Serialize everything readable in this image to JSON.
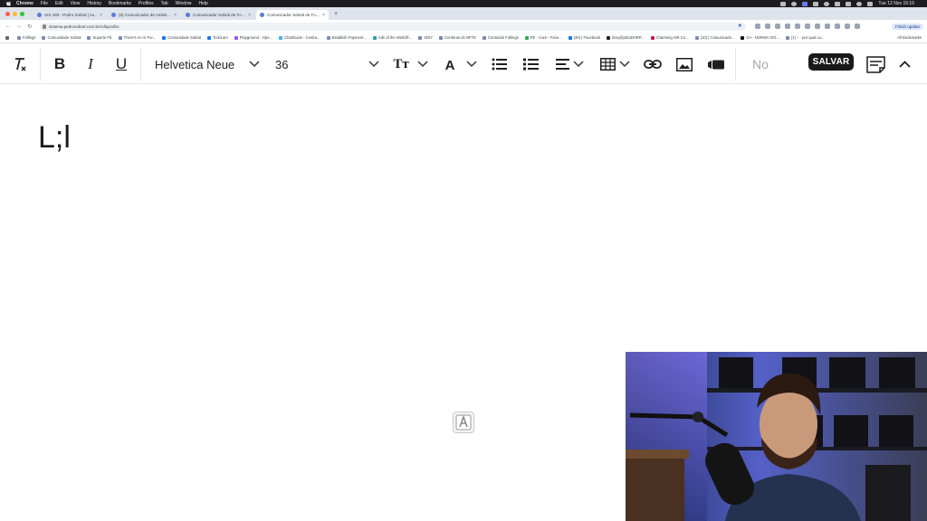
{
  "menubar": {
    "app": "Chrome",
    "items": [
      "File",
      "Edit",
      "View",
      "History",
      "Bookmarks",
      "Profiles",
      "Tab",
      "Window",
      "Help"
    ],
    "clock": "Tue 12 Nov 15:16"
  },
  "tabs": [
    {
      "label": "UIX 183 - Pedro Sobral | Av...",
      "active": false
    },
    {
      "label": "(5) Comunicador de Ambiente...",
      "active": false
    },
    {
      "label": "Comunicador Sobral de Follow...",
      "active": false
    },
    {
      "label": "Comunicador Sobral de Follo...",
      "active": true
    }
  ],
  "address": {
    "url": "sistema.pedrosobral.com.br/rollupcdho",
    "finish_update": "Finish update"
  },
  "bookmarks": {
    "items": [
      "Follings",
      "Comunidade Sobral",
      "Suporte FE",
      "There's An AI For...",
      "Comunidade Sobral",
      "Tickit.am",
      "Playground - Ope...",
      "ChatGuias - Centra...",
      "Establish Payment...",
      "Ads of the World®...",
      "SDIY",
      "Conferas do NFTE",
      "Conteúdo Follings",
      "PE - Core - Face...",
      "(30) | Facebook",
      "lizey@pkraDHRP...",
      "Charming AIR Co...",
      "(10) | Comunicado...",
      "CA - NORMA VIG...",
      "(1) ↑ - por qual ca..."
    ],
    "all_label": "All Bookmarks"
  },
  "toolbar": {
    "bold": "B",
    "italic": "I",
    "underline": "U",
    "font_family": "Helvetica Neue",
    "font_size": "36",
    "text_size_icon": "Tт",
    "font_color_icon": "A",
    "status": "No",
    "save_label": "SALVAR"
  },
  "document": {
    "content": "L;l"
  },
  "colors": {
    "toolbar_icon": "#1f1f1f",
    "save_bg": "#1a1a1a",
    "tabstrip_bg": "#dfe3ec"
  }
}
